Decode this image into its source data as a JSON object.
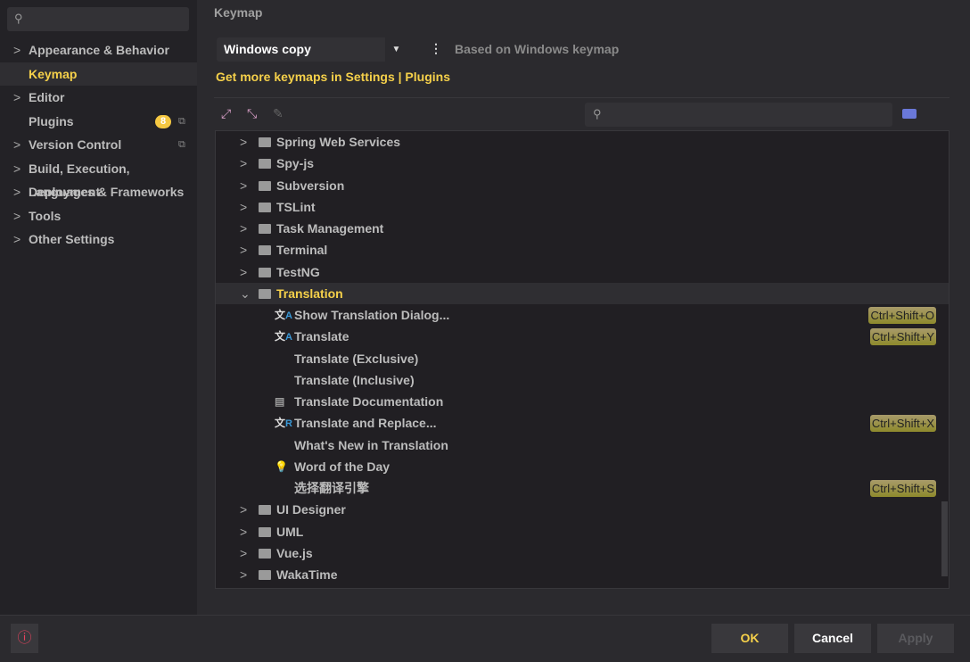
{
  "sidebar": {
    "items": [
      {
        "label": "Appearance & Behavior",
        "chevron": true
      },
      {
        "label": "Keymap",
        "selected": true
      },
      {
        "label": "Editor",
        "chevron": true
      },
      {
        "label": "Plugins",
        "badge": "8"
      },
      {
        "label": "Version Control",
        "chevron": true
      },
      {
        "label": "Build, Execution, Deployment",
        "chevron": true
      },
      {
        "label": "Languages & Frameworks",
        "chevron": true
      },
      {
        "label": "Tools",
        "chevron": true
      },
      {
        "label": "Other Settings",
        "chevron": true
      }
    ]
  },
  "header": {
    "title": "Keymap",
    "keymap_value": "Windows copy",
    "based_on": "Based on Windows keymap",
    "link": "Get more keymaps in Settings | Plugins"
  },
  "tree": {
    "rows": [
      {
        "label": "Spring Web Services",
        "type": "folder"
      },
      {
        "label": "Spy-js",
        "type": "folder"
      },
      {
        "label": "Subversion",
        "type": "folder"
      },
      {
        "label": "TSLint",
        "type": "folder"
      },
      {
        "label": "Task Management",
        "type": "folder"
      },
      {
        "label": "Terminal",
        "type": "folder"
      },
      {
        "label": "TestNG",
        "type": "folder"
      },
      {
        "label": "Translation",
        "type": "folder",
        "expanded": true
      },
      {
        "label": "Show Translation Dialog...",
        "type": "action",
        "icon": "translate-icon",
        "shortcut": "Ctrl+Shift+O"
      },
      {
        "label": "Translate",
        "type": "action",
        "icon": "translate-icon",
        "shortcut": "Ctrl+Shift+Y"
      },
      {
        "label": "Translate (Exclusive)",
        "type": "action"
      },
      {
        "label": "Translate (Inclusive)",
        "type": "action"
      },
      {
        "label": "Translate Documentation",
        "type": "action",
        "icon": "document-icon"
      },
      {
        "label": "Translate and Replace...",
        "type": "action",
        "icon": "translate-replace-icon",
        "shortcut": "Ctrl+Shift+X"
      },
      {
        "label": "What's New in Translation",
        "type": "action"
      },
      {
        "label": "Word of the Day",
        "type": "action",
        "icon": "lightbulb-icon"
      },
      {
        "label": "选择翻译引擎",
        "type": "action",
        "shortcut": "Ctrl+Shift+S"
      },
      {
        "label": "UI Designer",
        "type": "folder"
      },
      {
        "label": "UML",
        "type": "folder"
      },
      {
        "label": "Vue.js",
        "type": "folder"
      },
      {
        "label": "WakaTime",
        "type": "folder"
      }
    ]
  },
  "footer": {
    "ok": "OK",
    "cancel": "Cancel",
    "apply": "Apply"
  },
  "colors": {
    "accent": "#f5d04a",
    "shortcut": "#8e8a2c",
    "help": "#e8435e"
  }
}
